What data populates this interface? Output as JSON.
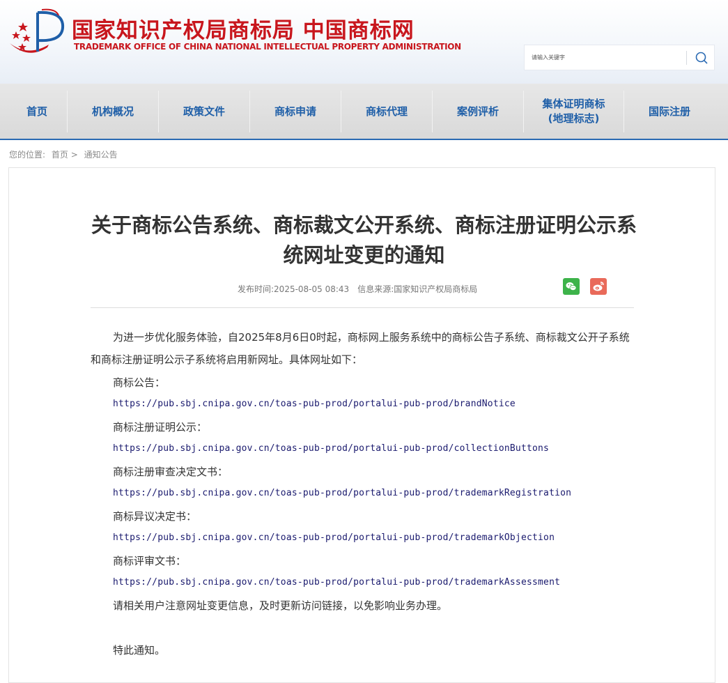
{
  "header": {
    "title_cn": "国家知识产权局商标局 中国商标网",
    "title_en": "TRADEMARK OFFICE OF CHINA NATIONAL INTELLECTUAL PROPERTY ADMINISTRATION",
    "search_placeholder": "请输入关键字",
    "brand_color": "#c8161d"
  },
  "nav": {
    "items": [
      {
        "label": "首页"
      },
      {
        "label": "机构概况"
      },
      {
        "label": "政策文件"
      },
      {
        "label": "商标申请"
      },
      {
        "label": "商标代理"
      },
      {
        "label": "案例评析"
      },
      {
        "label": "集体证明商标\n(地理标志)"
      },
      {
        "label": "国际注册"
      }
    ],
    "accent_color": "#1f5fa8"
  },
  "breadcrumb": {
    "prefix": "您的位置:",
    "home": "首页",
    "separator": ">",
    "current": "通知公告"
  },
  "article": {
    "title": "关于商标公告系统、商标裁文公开系统、商标注册证明公示系统网址变更的通知",
    "publish_label": "发布时间:",
    "publish_time": "2025-08-05 08:43",
    "source_label": "信息来源:",
    "source": "国家知识产权局商标局",
    "intro": "为进一步优化服务体验，自2025年8月6日0时起，商标网上服务系统中的商标公告子系统、商标裁文公开子系统和商标注册证明公示子系统将启用新网址。具体网址如下：",
    "entries": [
      {
        "label": "商标公告：",
        "url": "https://pub.sbj.cnipa.gov.cn/toas-pub-prod/portalui-pub-prod/brandNotice"
      },
      {
        "label": "商标注册证明公示：",
        "url": "https://pub.sbj.cnipa.gov.cn/toas-pub-prod/portalui-pub-prod/collectionButtons"
      },
      {
        "label": "商标注册审查决定文书：",
        "url": "https://pub.sbj.cnipa.gov.cn/toas-pub-prod/portalui-pub-prod/trademarkRegistration"
      },
      {
        "label": "商标异议决定书：",
        "url": "https://pub.sbj.cnipa.gov.cn/toas-pub-prod/portalui-pub-prod/trademarkObjection"
      },
      {
        "label": "商标评审文书：",
        "url": "https://pub.sbj.cnipa.gov.cn/toas-pub-prod/portalui-pub-prod/trademarkAssessment"
      }
    ],
    "reminder": "请相关用户注意网址变更信息，及时更新访问链接，以免影响业务办理。",
    "closing": "特此通知。"
  },
  "share": {
    "wechat_icon": "wechat-icon",
    "weibo_icon": "weibo-icon",
    "wechat_color": "#3db34a",
    "weibo_color": "#e96a5a"
  }
}
